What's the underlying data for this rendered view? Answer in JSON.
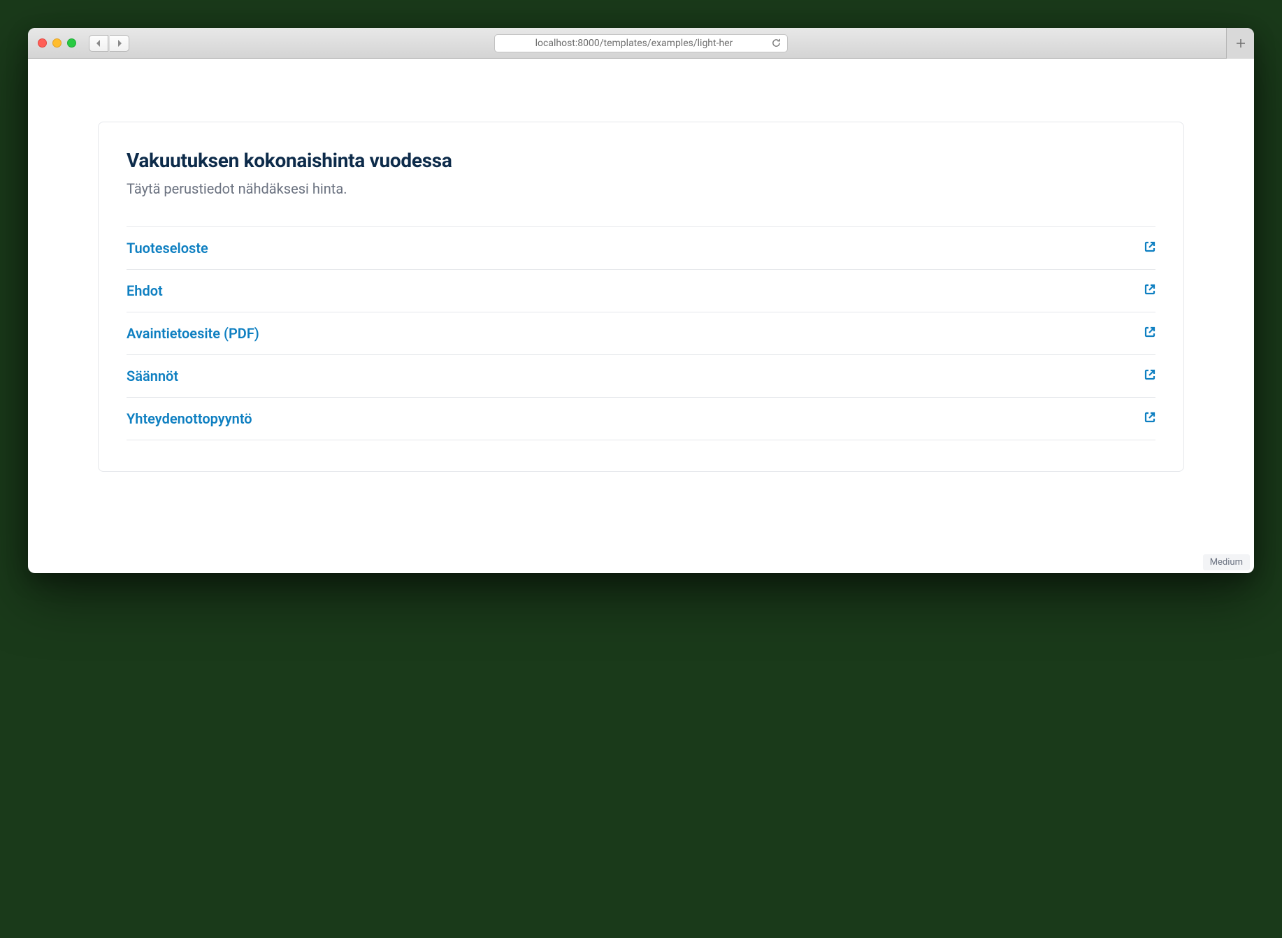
{
  "browser": {
    "url": "localhost:8000/templates/examples/light-her",
    "new_tab_label": "New Tab"
  },
  "card": {
    "title": "Vakuutuksen kokonaishinta vuodessa",
    "subtitle": "Täytä perustiedot nähdäksesi hinta.",
    "links": [
      {
        "label": "Tuoteseloste"
      },
      {
        "label": "Ehdot"
      },
      {
        "label": "Avaintietoesite (PDF)"
      },
      {
        "label": "Säännöt"
      },
      {
        "label": "Yhteydenottopyyntö"
      }
    ]
  },
  "badge": "Medium"
}
